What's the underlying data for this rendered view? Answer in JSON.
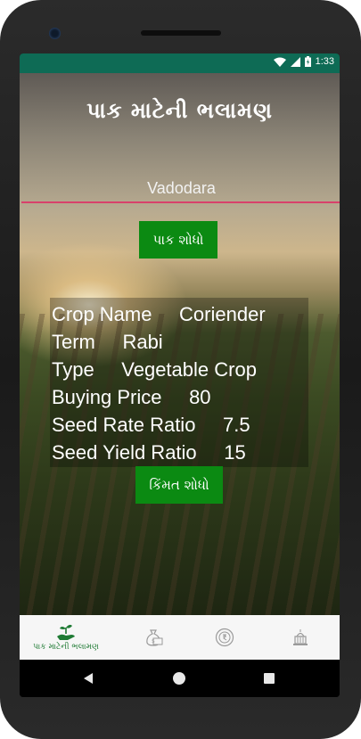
{
  "status_bar": {
    "time": "1:33"
  },
  "header": {
    "title": "પાક માટેની ભલામણ"
  },
  "search": {
    "city_value": "Vadodara",
    "find_crop_label": "પાક શોધો"
  },
  "crop_info": {
    "rows": [
      "Crop Name     Coriender",
      "Term     Rabi",
      "Type     Vegetable Crop",
      "Buying Price     80",
      "Seed Rate Ratio     7.5",
      "Seed Yield Ratio     15"
    ],
    "find_price_label": "કિંમત શોધો"
  },
  "bottom_nav": {
    "items": [
      {
        "label": "પાક માટેની ભલામણ",
        "icon": "plant-hand-icon",
        "active": true
      },
      {
        "label": "",
        "icon": "money-bag-icon",
        "active": false
      },
      {
        "label": "",
        "icon": "coin-icon",
        "active": false
      },
      {
        "label": "",
        "icon": "government-building-icon",
        "active": false
      }
    ]
  },
  "colors": {
    "status_bar": "#0e6b55",
    "button_green": "#0b8a12",
    "input_underline": "#d8416b",
    "active_nav": "#1e7a33"
  }
}
